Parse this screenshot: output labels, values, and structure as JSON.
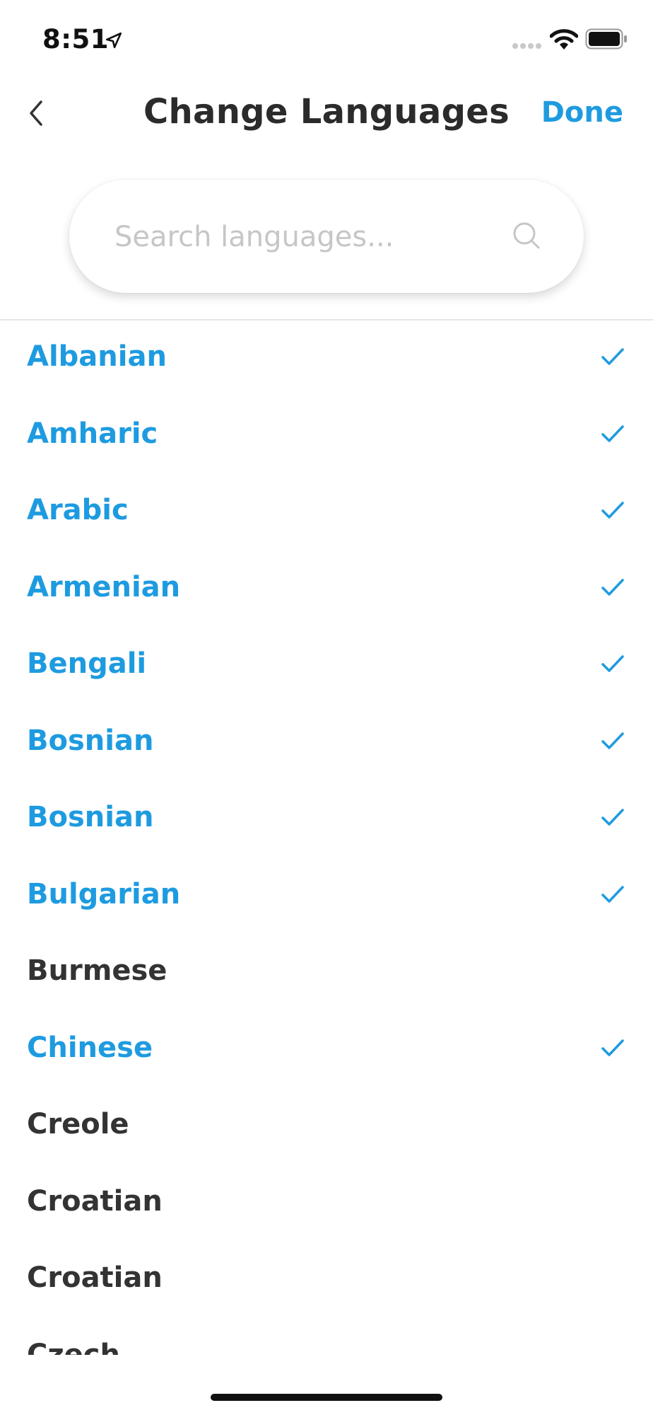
{
  "status_bar": {
    "time": "8:51"
  },
  "nav": {
    "title": "Change Languages",
    "done_label": "Done"
  },
  "search": {
    "placeholder": "Search languages...",
    "value": ""
  },
  "colors": {
    "accent": "#1e9be0",
    "text_default": "#333333"
  },
  "languages": [
    {
      "label": "Albanian",
      "selected": true
    },
    {
      "label": "Amharic",
      "selected": true
    },
    {
      "label": "Arabic",
      "selected": true
    },
    {
      "label": "Armenian",
      "selected": true
    },
    {
      "label": "Bengali",
      "selected": true
    },
    {
      "label": "Bosnian",
      "selected": true
    },
    {
      "label": "Bosnian",
      "selected": true
    },
    {
      "label": "Bulgarian",
      "selected": true
    },
    {
      "label": "Burmese",
      "selected": false
    },
    {
      "label": "Chinese",
      "selected": true
    },
    {
      "label": "Creole",
      "selected": false
    },
    {
      "label": "Croatian",
      "selected": false
    },
    {
      "label": "Croatian",
      "selected": false
    },
    {
      "label": "Czech",
      "selected": false
    }
  ]
}
